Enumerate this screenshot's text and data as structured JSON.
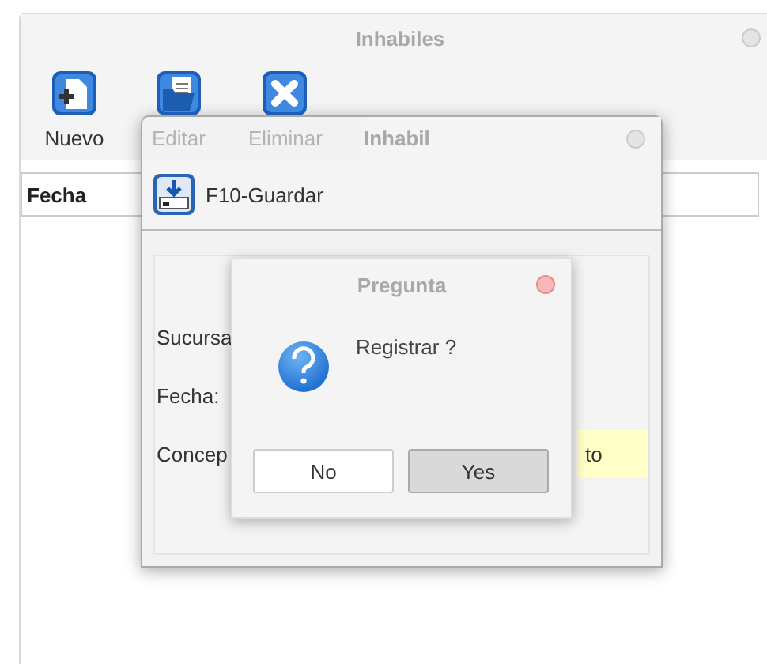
{
  "main_window": {
    "title": "Inhabiles",
    "toolbar": [
      {
        "label": "Nuevo",
        "kind": "new",
        "disabled": false
      },
      {
        "label": "Editar",
        "kind": "edit",
        "disabled": true
      },
      {
        "label": "Eliminar",
        "kind": "delete",
        "disabled": true
      }
    ],
    "table": {
      "columns": [
        "Fecha"
      ]
    }
  },
  "dialog": {
    "title": "Inhabil",
    "toolbar": [
      {
        "label": "F10-Guardar",
        "kind": "save"
      }
    ],
    "fields": [
      {
        "label": "Sucursa"
      },
      {
        "label": "Fecha:"
      },
      {
        "label": "Concep",
        "value": "to"
      }
    ]
  },
  "prompt": {
    "title": "Pregunta",
    "message": "Registrar ?",
    "buttons": [
      {
        "label": "No",
        "default": false
      },
      {
        "label": "Yes",
        "default": true
      }
    ]
  }
}
